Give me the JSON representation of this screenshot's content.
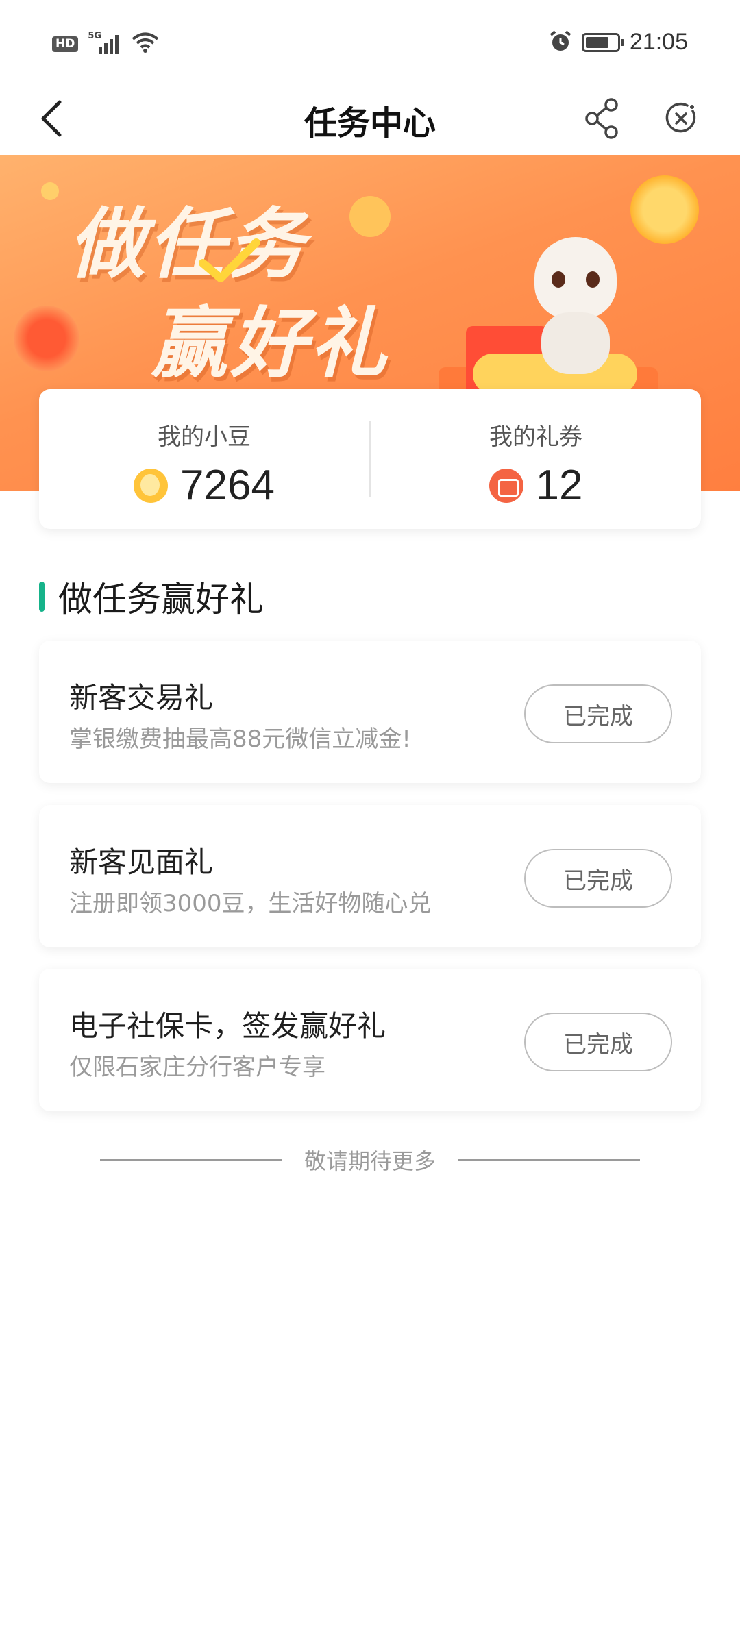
{
  "status_bar": {
    "hd": "HD",
    "network": "5G",
    "time": "21:05",
    "battery_level": 0.75
  },
  "nav": {
    "title": "任务中心",
    "icons": [
      "back-icon",
      "share-icon",
      "close-mini-program-icon"
    ]
  },
  "banner": {
    "line1": "做任务",
    "line2": "赢好礼"
  },
  "summary": {
    "beans_label": "我的小豆",
    "beans_value": "7264",
    "coupons_label": "我的礼券",
    "coupons_value": "12"
  },
  "section": {
    "title": "做任务赢好礼",
    "accent_color": "#16b38a"
  },
  "tasks": [
    {
      "title": "新客交易礼",
      "desc": "掌银缴费抽最高88元微信立减金!",
      "button": "已完成"
    },
    {
      "title": "新客见面礼",
      "desc": "注册即领3000豆，生活好物随心兑",
      "button": "已完成"
    },
    {
      "title": "电子社保卡，签发赢好礼",
      "desc": "仅限石家庄分行客户专享",
      "button": "已完成"
    }
  ],
  "footer": {
    "text": "敬请期待更多"
  },
  "colors": {
    "banner_orange": "#ff9250",
    "coin_gold": "#ffc43a",
    "coupon_red": "#f46443"
  }
}
